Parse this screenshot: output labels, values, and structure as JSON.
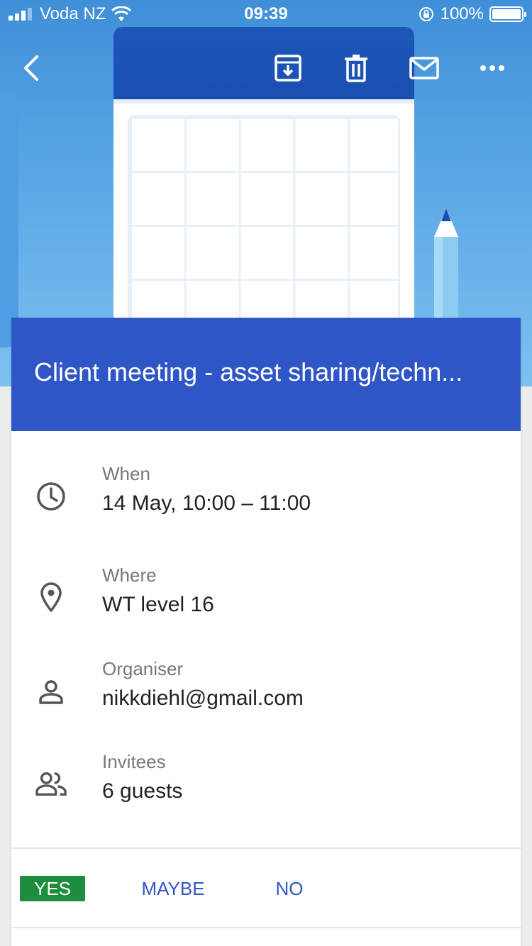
{
  "status_bar": {
    "carrier": "Voda NZ",
    "time": "09:39",
    "battery": "100%"
  },
  "toolbar": {
    "back_icon": "chevron-left-icon",
    "archive_icon": "archive-icon",
    "delete_icon": "trash-icon",
    "mail_icon": "mail-icon",
    "more_icon": "more-horizontal-icon"
  },
  "event": {
    "title": "Client meeting - asset sharing/techn...",
    "when_label": "When",
    "when_value": "14 May, 10:00 – 11:00",
    "where_label": "Where",
    "where_value": "WT level 16",
    "organiser_label": "Organiser",
    "organiser_value": "nikkdiehl@gmail.com",
    "invitees_label": "Invitees",
    "invitees_value": "6 guests"
  },
  "rsvp": {
    "yes": "YES",
    "maybe": "MAYBE",
    "no": "NO"
  },
  "colors": {
    "header_blue": "#2f56c6",
    "yes_green": "#1e8e3e",
    "link_blue": "#2f56c6"
  }
}
